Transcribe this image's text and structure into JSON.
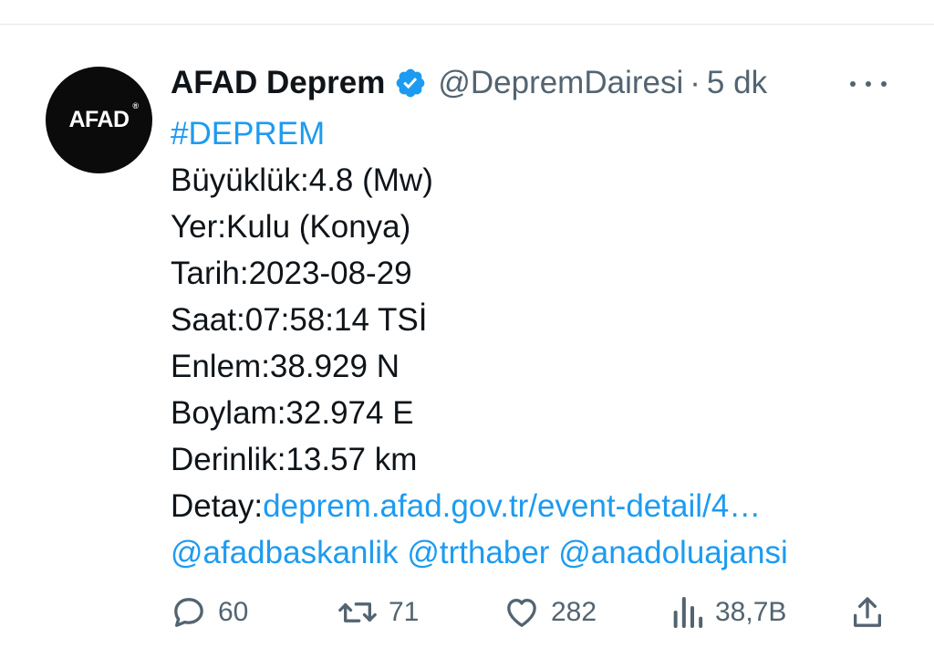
{
  "avatar": {
    "logo_text": "AFAD",
    "reg_mark": "®"
  },
  "header": {
    "name": "AFAD Deprem",
    "handle": "@DepremDairesi",
    "separator": "·",
    "time": "5 dk"
  },
  "tweet": {
    "hashtag": "#DEPREM",
    "lines": [
      "Büyüklük:4.8 (Mw)",
      "Yer:Kulu (Konya)",
      "Tarih:2023-08-29",
      "Saat:07:58:14 TSİ",
      "Enlem:38.929 N",
      "Boylam:32.974 E",
      "Derinlik:13.57 km"
    ],
    "detail_label": "Detay:",
    "detail_link": "deprem.afad.gov.tr/event-detail/4…",
    "mentions": [
      "@afadbaskanlik",
      "@trthaber",
      "@anadoluajansi"
    ]
  },
  "actions": {
    "replies": "60",
    "retweets": "71",
    "likes": "282",
    "views": "38,7B"
  },
  "colors": {
    "link": "#1d9bf0",
    "text": "#0f1419",
    "muted": "#536471",
    "verified": "#1d9bf0"
  },
  "icons": [
    "verified-badge-icon",
    "more-icon",
    "reply-icon",
    "retweet-icon",
    "like-icon",
    "views-icon",
    "share-icon"
  ]
}
